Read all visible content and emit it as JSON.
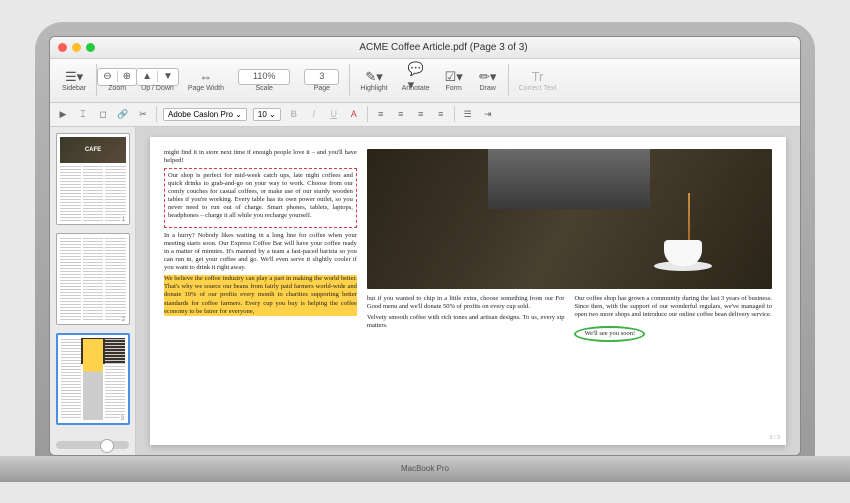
{
  "window": {
    "title": "ACME Coffee Article.pdf (Page 3 of 3)"
  },
  "toolbar": {
    "sidebar": "Sidebar",
    "zoom": "Zoom",
    "updown": "Up / Down",
    "pagewidth": "Page Width",
    "scale": "Scale",
    "scale_value": "110%",
    "page": "Page",
    "page_value": "3",
    "highlight": "Highlight",
    "annotate": "Annotate",
    "form": "Form",
    "draw": "Draw",
    "correct": "Correct Text"
  },
  "edittool": {
    "font": "Adobe Caslon Pro",
    "size": "10"
  },
  "thumbs": [
    {
      "label": "1",
      "cafe": "CAFE"
    },
    {
      "label": "2"
    },
    {
      "label": "3"
    }
  ],
  "article": {
    "col1": {
      "lead": "might find it in store next time if enough people love it – and you'll have helped!",
      "boxed": "Our shop is perfect for mid-week catch ups, late night coffees and quick drinks to grab-and-go on your way to work. Choose from our comfy couches for casual coffees, or make use of our sturdy wooden tables if you're working. Every table has its own power outlet, so you never need to run out of charge. Smart phones, tablets, laptops, headphones – charge it all while you recharge yourself.",
      "hurry": "In a hurry? Nobody likes waiting in a long line for coffee when your meeting starts soon. Our Express Coffee Bar will have your coffee ready in a matter of minutes. It's manned by a team a fast-paced barista so you can run in, get your coffee and go. We'll even serve it slightly cooler if you want to drink it right away.",
      "highlighted": "We believe the coffee industry can play a part in making the world better. That's why we source our beans from fairly paid farmers world-wide and donate 10% of our profits every month to charities supporting better standards for coffee farmers. Every cup you buy is helping the coffee economy to be fairer for everyone,"
    },
    "col2": {
      "p1": "but if you wanted to chip in a little extra, choose something from our For Good menu and we'll donate 50% of profits on every cup sold.",
      "p2": "Velvety smooth coffee with rich tones and artisan designs. To us, every sip matters."
    },
    "col3": {
      "p1": "Our coffee shop has grown a community during the last 3 years of business. Since then, with the support of our wonderful regulars, we've managed to open two more shops and introduce our online coffee bean delivery service.",
      "cta": "We'll see you soon!"
    },
    "pagenum": "3 / 3"
  },
  "laptop": {
    "model": "MacBook Pro"
  }
}
